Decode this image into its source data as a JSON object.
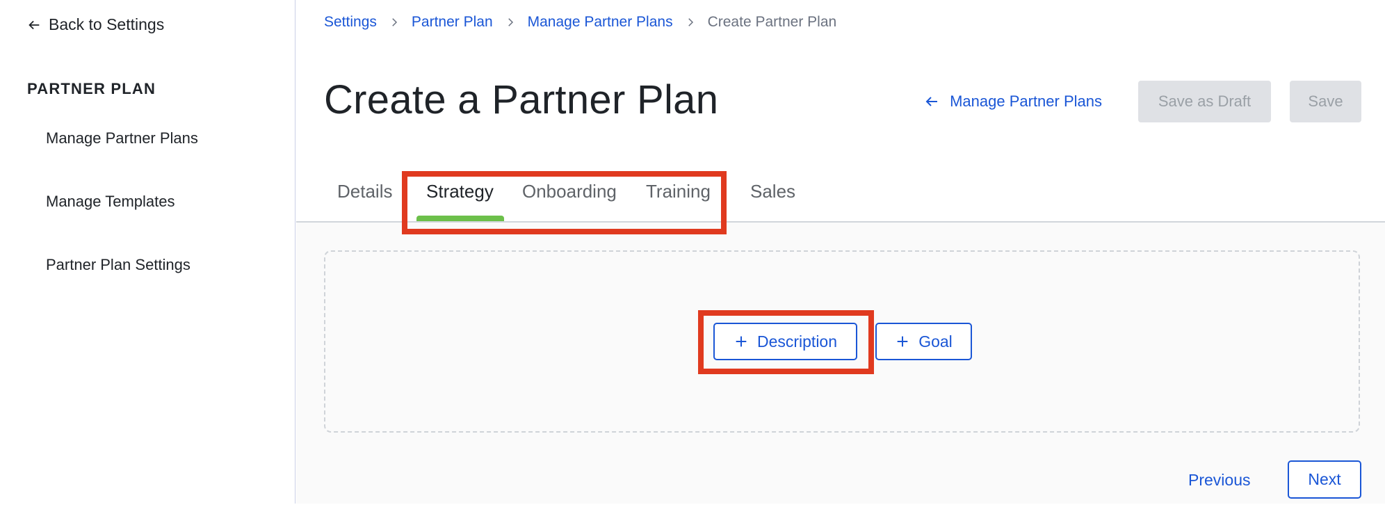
{
  "sidebar": {
    "back_label": "Back to Settings",
    "section_title": "PARTNER PLAN",
    "items": [
      {
        "label": "Manage Partner Plans"
      },
      {
        "label": "Manage Templates"
      },
      {
        "label": "Partner Plan Settings"
      }
    ]
  },
  "breadcrumb": {
    "items": [
      "Settings",
      "Partner Plan",
      "Manage Partner Plans"
    ],
    "current": "Create Partner Plan"
  },
  "header": {
    "title": "Create a Partner Plan",
    "manage_link": "Manage Partner Plans",
    "save_draft": "Save as Draft",
    "save": "Save"
  },
  "tabs": [
    {
      "label": "Details",
      "active": false
    },
    {
      "label": "Strategy",
      "active": true
    },
    {
      "label": "Onboarding",
      "active": false
    },
    {
      "label": "Training",
      "active": false
    },
    {
      "label": "Sales",
      "active": false
    }
  ],
  "content": {
    "add_description": "Description",
    "add_goal": "Goal"
  },
  "footer": {
    "previous": "Previous",
    "next": "Next"
  },
  "colors": {
    "link": "#1a56d6",
    "active_tab_indicator": "#6cc04a",
    "highlight": "#e03a1f",
    "disabled_button_bg": "#dfe1e5"
  },
  "icons": [
    "arrow-left-icon",
    "chevron-right-icon",
    "plus-icon"
  ]
}
